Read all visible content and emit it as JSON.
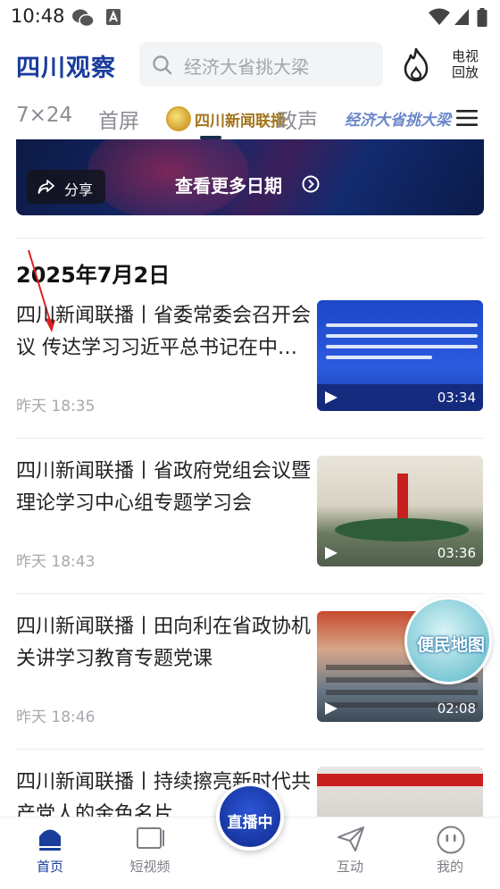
{
  "status_bar": {
    "time": "10:48",
    "icons": [
      "wechat-icon",
      "notification-a-icon",
      "wifi-icon",
      "signal-icon",
      "battery-icon"
    ]
  },
  "header": {
    "logo": "四川观察",
    "search_placeholder": "经济大省挑大梁",
    "hot_icon": "flame-icon",
    "tv_replay_label_line1": "电视",
    "tv_replay_label_line2": "回放"
  },
  "tabs": {
    "items": [
      {
        "label": "7×24"
      },
      {
        "label": "首屏"
      },
      {
        "label": "四川新闻联播",
        "active": true
      },
      {
        "label": "政声"
      },
      {
        "label": "经济大省挑大梁"
      }
    ]
  },
  "banner": {
    "share_label": "分享",
    "more_dates_label": "查看更多日期"
  },
  "feed": {
    "date_heading": "2025年7月2日",
    "items": [
      {
        "title": "四川新闻联播丨省委常委会召开会议 传达学习习近平总书记在中央政治局会议上的重要讲话精神",
        "time": "昨天 18:35",
        "duration": "03:34"
      },
      {
        "title": "四川新闻联播丨省政府党组会议暨理论学习中心组专题学习会",
        "time": "昨天 18:43",
        "duration": "03:36"
      },
      {
        "title": "四川新闻联播丨田向利在省政协机关讲学习教育专题党课",
        "time": "昨天 18:46",
        "duration": "02:08"
      },
      {
        "title": "四川新闻联播丨持续擦亮新时代共产党人的金色名片",
        "time": "",
        "duration": ""
      }
    ],
    "floating_badge": "便民地图"
  },
  "bottom_nav": {
    "items": [
      {
        "label": "首页",
        "active": true
      },
      {
        "label": "短视频"
      },
      {
        "label": "互动"
      },
      {
        "label": "我的"
      }
    ],
    "live_label": "直播中"
  },
  "colors": {
    "brand_blue": "#1a3d9c",
    "text_dark": "#222222",
    "text_muted": "#a5a8ad"
  }
}
